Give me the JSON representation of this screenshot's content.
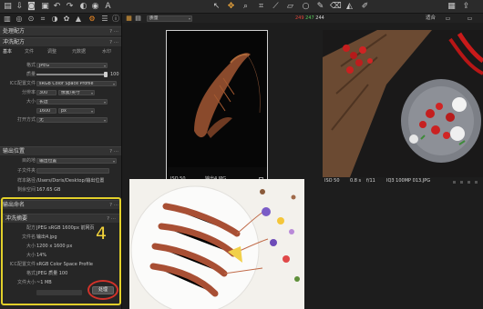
{
  "toolbar": {
    "icons": [
      "folder-icon",
      "import-icon",
      "camera-icon",
      "viewer-icon",
      "undo-icon",
      "redo-icon",
      "color-icon",
      "adjust-icon",
      "text-tool-icon",
      "cursor-icon",
      "pan-icon",
      "zoom-icon",
      "crop-icon",
      "straighten-icon",
      "keystone-icon",
      "circle-icon",
      "brush-icon",
      "eraser-icon",
      "gradient-icon",
      "picker-icon",
      "grid-icon",
      "export-icon"
    ]
  },
  "left_panel": {
    "process_recipe": {
      "title": "处理配方",
      "controls": "? ···"
    },
    "recipe_list": {
      "title": "冲洗配方",
      "controls": "? ···"
    },
    "subtabs": [
      "基本",
      "文件",
      "调整",
      "元数据",
      "水印"
    ],
    "format_fields": [
      {
        "label": "格式",
        "value": "JPEG"
      },
      {
        "label": "质量",
        "value": "100"
      },
      {
        "label": "ICC配置文件",
        "value": "sRGB Color Space Profile"
      },
      {
        "label": "分辨率",
        "value": "300",
        "unit": "像素/英寸"
      },
      {
        "label": "大小",
        "value": "长边"
      },
      {
        "label": "",
        "value": "1600",
        "unit": "px"
      },
      {
        "label": "打开方式",
        "value": "无"
      }
    ],
    "output_location": {
      "title": "输出位置",
      "controls": "? ···",
      "fields": [
        {
          "label": "目的地",
          "value": "输出位置"
        },
        {
          "label": "子文件夹",
          "value": ""
        },
        {
          "label": "样本路径",
          "value": "/Users/Doris/Desktop/输出位置"
        },
        {
          "label": "剩余空间",
          "value": "167.65 GB"
        }
      ]
    },
    "output_naming": {
      "title": "输出命名",
      "controls": "? ···"
    },
    "process_summary": {
      "title": "冲洗摘要",
      "controls": "? ···",
      "fields": [
        {
          "label": "配方",
          "value": "JPEG sRGB 1600px 前网页"
        },
        {
          "label": "文件名",
          "value": "输出4.jpg"
        },
        {
          "label": "大小",
          "value": "1200 x 1600 px"
        },
        {
          "label": "大小",
          "value": "14%"
        },
        {
          "label": "ICC配置文件",
          "value": "sRGB Color Space Profile"
        },
        {
          "label": "格式",
          "value": "JPEG 质量 100"
        },
        {
          "label": "文件大小",
          "value": "~1 MB"
        }
      ],
      "process_button": "处理",
      "step_number": "4"
    }
  },
  "browser": {
    "sort_value": "质量",
    "counter": {
      "a": "249",
      "b": "247",
      "c": "244"
    },
    "counter_colors": {
      "a": "#e0463a",
      "b": "#58c95a",
      "c": "#d8d8d8"
    },
    "fit_label": "适合",
    "thumbnails": [
      {
        "iso": "ISO 50",
        "name": "输出4.JPG"
      },
      {
        "iso": "ISO 50",
        "exposure": "0.8 s",
        "aperture": "f/11",
        "name": "IQ3 100MP 013.JPG"
      }
    ]
  },
  "colors": {
    "accent_orange": "#f08a24",
    "highlight_yellow": "#e2d02a",
    "circle_red": "#d1322a"
  }
}
